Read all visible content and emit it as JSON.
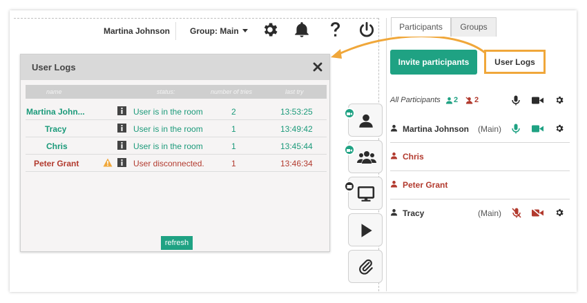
{
  "header": {
    "user_name": "Martina Johnson",
    "group_label": "Group: Main",
    "icons": [
      "gear-icon",
      "bell-icon",
      "help-icon",
      "power-icon"
    ]
  },
  "user_logs": {
    "title": "User Logs",
    "columns": {
      "name": "name",
      "status": "status:",
      "tries": "number of tries",
      "last": "last try"
    },
    "rows": [
      {
        "name": "Martina John...",
        "status": "User is in the room",
        "tries": "2",
        "last": "13:53:25",
        "state": "ok"
      },
      {
        "name": "Tracy",
        "status": "User is in the room",
        "tries": "1",
        "last": "13:49:42",
        "state": "ok"
      },
      {
        "name": "Chris",
        "status": "User is in the room",
        "tries": "1",
        "last": "13:45:44",
        "state": "ok"
      },
      {
        "name": "Peter Grant",
        "status": "User disconnected.",
        "tries": "1",
        "last": "13:46:34",
        "state": "bad"
      }
    ],
    "refresh_label": "refresh"
  },
  "side_toolbar": [
    "user-icon",
    "group-icon",
    "screen-share-icon",
    "play-icon",
    "paperclip-icon"
  ],
  "panel": {
    "tabs": [
      "Participants",
      "Groups"
    ],
    "invite_label": "Invite participants",
    "user_logs_label": "User Logs",
    "all_participants_label": "All Participants",
    "online_count": "2",
    "offline_count": "2",
    "participants": [
      {
        "name": "Martina Johnson",
        "group": "(Main)",
        "state": "ok"
      },
      {
        "name": "Chris",
        "group": "",
        "state": "bad"
      },
      {
        "name": "Peter Grant",
        "group": "",
        "state": "bad"
      },
      {
        "name": "Tracy",
        "group": "(Main)",
        "state": "muted"
      }
    ]
  },
  "colors": {
    "accent": "#1fa283",
    "danger": "#b23a2e",
    "highlight": "#f0a73a"
  }
}
